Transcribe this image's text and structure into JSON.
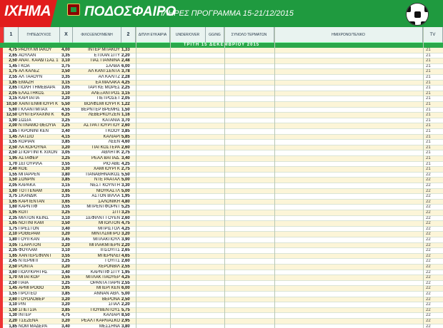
{
  "header": {
    "brand": "ΠΑΜΕ ΣΤΟΙΧΗΜΑ",
    "brand_visible": "ΙΧΗΜΑ",
    "sport": "ΠΟΔΟΣΦΑΙΡΟ",
    "schedule": "ΠΛΗΡΕΣ ΠΡΟΓΡΑΜΜΑ 15-21/12/2015"
  },
  "columns": {
    "c1": "1",
    "home": "ΓΗΠΕΔΟΥΧΟΣ",
    "x": "X",
    "away": "ΦΙΛΟΞΕΝΟΥΜΕΝΗ",
    "c2": "2",
    "dc": "ΔΙΠΛΗ ΕΥΚΑΙΡΙΑ",
    "uo": "UNDER/OVER",
    "gg": "GG/NG",
    "goals": "ΣΥΝΟΛΟ ΤΕΡΜΑΤΩΝ",
    "ht": "ΗΜΙΧΡΟΝΟ/ΤΕΛΙΚΟ",
    "tv": "TV"
  },
  "day_label": "ΤΡΙΤΗ 15 ΔΕΚΕΜΒΡΙΟΥ 2015",
  "colors": {
    "banner_green": "#1f9a3f",
    "brand_red": "#e11c1c",
    "row_yellow": "#fcf5d8"
  },
  "rows": [
    {
      "o1": "4,75",
      "home": "ΡΑΟΥΛ ΜΠΑΚΟΥ",
      "x": "4,00",
      "away": "ΙΝΤΕΡ ΜΠΑΚΟΥ",
      "o2": "1,33",
      "code": "21"
    },
    {
      "o1": "2,65",
      "home": "ΑΟΥΛΑΝ",
      "x": "3,35",
      "away": "ΕΤΙΧΑΝ ΣΙΤΥ",
      "o2": "2,20",
      "code": "21"
    },
    {
      "o1": "2,50",
      "home": "ΑΝΑΓ. ΚΑΡΔΙΤΣΑΣ 1906",
      "x": "3,10",
      "away": "ΠΑΣ ΓΙΑΝΝΙΝΑ",
      "o2": "2,48",
      "code": "21"
    },
    {
      "o1": "1,45",
      "home": "ΓΚΟΑ",
      "x": "3,75",
      "away": "ΣΑΛΒΑ",
      "o2": "6,00",
      "code": "21"
    },
    {
      "o1": "1,75",
      "home": "ΑΛ ΚΑΛΕΖ",
      "x": "3,50",
      "away": "ΑΛ ΚΑΝΤΣΕΝΤΑ",
      "o2": "3,78",
      "code": "21"
    },
    {
      "o1": "2,55",
      "home": "ΑΛ ΤΑΑΟΥΝ",
      "x": "3,35",
      "away": "ΑΛ ΚΑΛΙΤΖ",
      "o2": "2,28",
      "code": "21"
    },
    {
      "o1": "1,85",
      "home": "ΕΜΑΖΗ",
      "x": "3,15",
      "away": "ΕΑ ΜΑΛΑΚΑ",
      "o2": "4,25",
      "code": "21"
    },
    {
      "o1": "2,65",
      "home": "ΠΟΛΗ ΤΗΜΕΒΑΡΑ",
      "x": "3,05",
      "away": "ΤΑΡΓΚΕ ΜΟΡΕΣ",
      "o2": "2,25",
      "code": "21"
    },
    {
      "o1": "2,05",
      "home": "ΕΛΑΣΤΗΚΟΣ",
      "x": "3,10",
      "away": "ΑΛΕΞΑΝΤΡΟΣ",
      "o2": "3,15",
      "code": "21"
    },
    {
      "o1": "3,15",
      "home": "ΚΑΡΠΑΤΙΑ",
      "x": "3,20",
      "away": "ΠΕΤΡΟΣΕΤ",
      "o2": "2,05",
      "code": "21"
    },
    {
      "o1": "10,50",
      "home": "ΧΑΙΝΤΕΝΜΠΟΥΡΓΚ",
      "x": "5,50",
      "away": "ΒΟΛΦΣΜΠΟΥΡΓΚ",
      "o2": "1,22",
      "code": "21"
    },
    {
      "o1": "5,60",
      "home": "ΓΚΛΑΝΤΜΠΑΧ",
      "x": "4,55",
      "away": "ΒΕΡΝΤΕΡ ΒΡΕΜΗΣ",
      "o2": "1,50",
      "code": "21"
    },
    {
      "o1": "12,50",
      "home": "ΟΥΝΤΕΡΧΑΧΙΝΓΚ",
      "x": "6,25",
      "away": "ΛΕΒΕΡΚΟΥΖΕΝ",
      "o2": "1,16",
      "code": "21"
    },
    {
      "o1": "1,90",
      "home": "ΣΩΣΙΑ",
      "x": "3,25",
      "away": "ΚΑΤΑΝΙΑ",
      "o2": "3,70",
      "code": "21"
    },
    {
      "o1": "2,00",
      "home": "ΝΤΙΝΑΜΟ ΘΕΟΥΙΑ",
      "x": "3,25",
      "away": "ΑΣΤΡΑ ΓΙΟΥΡΓΙΟΥ",
      "o2": "2,60",
      "code": "21"
    },
    {
      "o1": "1,85",
      "home": "ΓΚΡΟΝΙΝΓΚΕΝ",
      "x": "3,40",
      "away": "ΓΚΟΟΥ",
      "o2": "3,85",
      "code": "21"
    },
    {
      "o1": "1,45",
      "home": "ΛΑΤΣΙΟ",
      "x": "4,15",
      "away": "ΚΑΛΙΑΡΙ",
      "o2": "5,85",
      "code": "21"
    },
    {
      "o1": "1,55",
      "home": "ΚΟΡΙΑΝ",
      "x": "3,85",
      "away": "ΛΕΕΝ",
      "o2": "4,60",
      "code": "21"
    },
    {
      "o1": "2,50",
      "home": "ΛΑ ΚΟΡΟΥΝΑ",
      "x": "3,20",
      "away": "ΠΑΓΚΟΣΤΕΡΑ",
      "o2": "2,60",
      "code": "21"
    },
    {
      "o1": "2,50",
      "home": "ΣΠΟΡΤΙΝΓΚ ΧΙΧΟΝ",
      "x": "3,05",
      "away": "ΑΘΛΗΤΙΚ",
      "o2": "2,75",
      "code": "21"
    },
    {
      "o1": "1,95",
      "home": "ΑΣΤΑΦΕΡ",
      "x": "3,25",
      "away": "ΡΕΑΛ ΒΑΓΙΑΔ.",
      "o2": "3,40",
      "code": "21"
    },
    {
      "o1": "1,70",
      "home": "ΣΕΓΟΥΡΙΛΑ",
      "x": "3,55",
      "away": "ΡΙΟ ΑΒΕ",
      "o2": "4,25",
      "code": "21"
    },
    {
      "o1": "2,40",
      "home": "ΚΟΕ",
      "x": "3,30",
      "away": "ΧΑΜΠΟΥΡΓΚ",
      "o2": "2,75",
      "code": "21"
    },
    {
      "o1": "1,55",
      "home": "ΜΠΑΡΡΕΝ",
      "x": "3,80",
      "away": "ΠΑΝΑΘΗΝΑΙΚΟΣ",
      "o2": "5,50",
      "code": "22"
    },
    {
      "o1": "1,50",
      "home": "ΣΟΝΡΙΝ",
      "x": "3,85",
      "away": "ΝΤΕ ΡΑΑΤΑΛ",
      "o2": "5,00",
      "code": "22"
    },
    {
      "o1": "2,05",
      "home": "ΚΑΡΑΚΑ",
      "x": "3,15",
      "away": "ΝΕΣΤ ΚΟΥΝΤΗ",
      "o2": "3,30",
      "code": "22"
    },
    {
      "o1": "1,60",
      "home": "ΤΟΤΤΕΝΑΜ",
      "x": "3,65",
      "away": "ΝΙΟΥΚΑΣΤΛ",
      "o2": "5,00",
      "code": "22"
    },
    {
      "o1": "3,75",
      "home": "ΣΚΑΝΔΙΚ",
      "x": "3,35",
      "away": "ΑΣΤΟΝ ΒΙΛΛΑ",
      "o2": "1,95",
      "code": "22"
    },
    {
      "o1": "1,65",
      "home": "ΚΑΡΠΕΝΤΑΝ",
      "x": "3,65",
      "away": "ΣΑΛΟΝΙΚΗ",
      "o2": "4,80",
      "code": "22"
    },
    {
      "o1": "1,60",
      "home": "ΚΑΡΝΤΙΦ",
      "x": "3,55",
      "away": "ΜΠΡΕΝΤΦΟΡΝΤ",
      "o2": "5,25",
      "code": "22"
    },
    {
      "o1": "1,95",
      "home": "ΚΟΠ",
      "x": "3,25",
      "away": "ΣΙΤΙ",
      "o2": "3,25",
      "code": "22"
    },
    {
      "o1": "2,35",
      "home": "ΜΙΛΤΟΝ ΚΕΪΝΣ",
      "x": "3,10",
      "away": "ΣΕΦΙΛΝΤ ΓΟΥΕΝ",
      "o2": "2,60",
      "code": "22"
    },
    {
      "o1": "1,65",
      "home": "ΝΟΤΙΝΓΚΑΜ",
      "x": "3,50",
      "away": "ΜΠΟΛΤΟΝ",
      "o2": "4,75",
      "code": "22"
    },
    {
      "o1": "1,75",
      "home": "ΠΡΕΣΤΟΝ",
      "x": "3,40",
      "away": "ΜΠΡΙΣΤΟΛ",
      "o2": "4,25",
      "code": "22"
    },
    {
      "o1": "2,10",
      "home": "ΡΟΘΕΡΑΜ",
      "x": "3,20",
      "away": "ΜΙΝΤΛΣΜΠΡΟ",
      "o2": "3,20",
      "code": "22"
    },
    {
      "o1": "1,80",
      "home": "ΓΟΥΙΓΚΑΝ",
      "x": "3,45",
      "away": "ΜΠΛΑΚΠΟΥΛ",
      "o2": "3,90",
      "code": "22"
    },
    {
      "o1": "3,05",
      "home": "ΤΣΑΡΛΤΟΝ",
      "x": "3,20",
      "away": "ΜΠΛΑΚΜΠΕΡΝ",
      "o2": "2,20",
      "code": "22"
    },
    {
      "o1": "2,35",
      "home": "ΦΟΥΛΑΜ",
      "x": "3,10",
      "away": "ΙΠΣΟΥΙΤΣ",
      "o2": "2,65",
      "code": "22"
    },
    {
      "o1": "1,65",
      "home": "ΧΑΝΤΕΡΣΦΙΛΝΤ",
      "x": "3,55",
      "away": "ΜΠΕΡΝΛΕΪ",
      "o2": "4,65",
      "code": "22"
    },
    {
      "o1": "2,45",
      "home": "ΝΤΕΡΜΠΙ",
      "x": "3,25",
      "away": "ΓΟΥΙΤΣ",
      "o2": "2,60",
      "code": "22"
    },
    {
      "o1": "2,50",
      "home": "ΡΟΝΤΑ",
      "x": "3,20",
      "away": "ΧΕΡΟΝΒΙΛ",
      "o2": "2,55",
      "code": "22"
    },
    {
      "o1": "3,60",
      "home": "ΠΟΛΥΚΡΗΤΗΣ",
      "x": "3,40",
      "away": "ΚΑΡΝΤΙΦ ΣΙΤΥ",
      "o2": "1,95",
      "code": "22"
    },
    {
      "o1": "1,70",
      "home": "ΜΠΑΓΚΟΡ",
      "x": "3,55",
      "away": "ΜΠΛΑΚ ΠΑΟΥΕΡ",
      "o2": "4,25",
      "code": "22"
    },
    {
      "o1": "2,50",
      "home": "ΠΑΙΑ",
      "x": "3,25",
      "away": "ΟΡΑΝΤΑ ΠΑΡΝ",
      "o2": "2,55",
      "code": "22"
    },
    {
      "o1": "1,45",
      "home": "ΑΡΜΠΡΟΘΟ",
      "x": "3,95",
      "away": "ΜΠΕΡΓΚΕΝ",
      "o2": "6,00",
      "code": "22"
    },
    {
      "o1": "1,55",
      "home": "ΠΡΟΤΕΟ",
      "x": "3,85",
      "away": "ΑΝΝΑΝ ΑΘΛ.",
      "o2": "5,00",
      "code": "22"
    },
    {
      "o1": "2,60",
      "home": "ΓΟΥΟΛΟΒΕΡ",
      "x": "3,20",
      "away": "ΒΕΡΟΝΑ",
      "o2": "2,50",
      "code": "22"
    },
    {
      "o1": "3,10",
      "home": "ΡΙΝ",
      "x": "3,20",
      "away": "ΣΠΑΛ",
      "o2": "2,20",
      "code": "22"
    },
    {
      "o1": "1,50",
      "home": "ΣΠΕΤΣΙΑ",
      "x": "3,85",
      "away": "ΓΙΟΥΒΕΝΤΟΥΣ",
      "o2": "5,75",
      "code": "22"
    },
    {
      "o1": "1,30",
      "home": "ΙΝΤΕΡ",
      "x": "4,75",
      "away": "ΚΑΛΙΑΡΙ",
      "o2": "8,50",
      "code": "22"
    },
    {
      "o1": "2,20",
      "home": "ΤΣΕΖΕΝΑ",
      "x": "3,20",
      "away": "ΡΕΑΛ ΓΚΑΡΛΙΑΣΚΟ",
      "o2": "2,95",
      "code": "22"
    },
    {
      "o1": "1,85",
      "home": "ΝΟΜ ΜΑΔΕΡΑ",
      "x": "3,40",
      "away": "ΜΕΣΣΗΝΑ",
      "o2": "3,80",
      "code": "22"
    }
  ]
}
